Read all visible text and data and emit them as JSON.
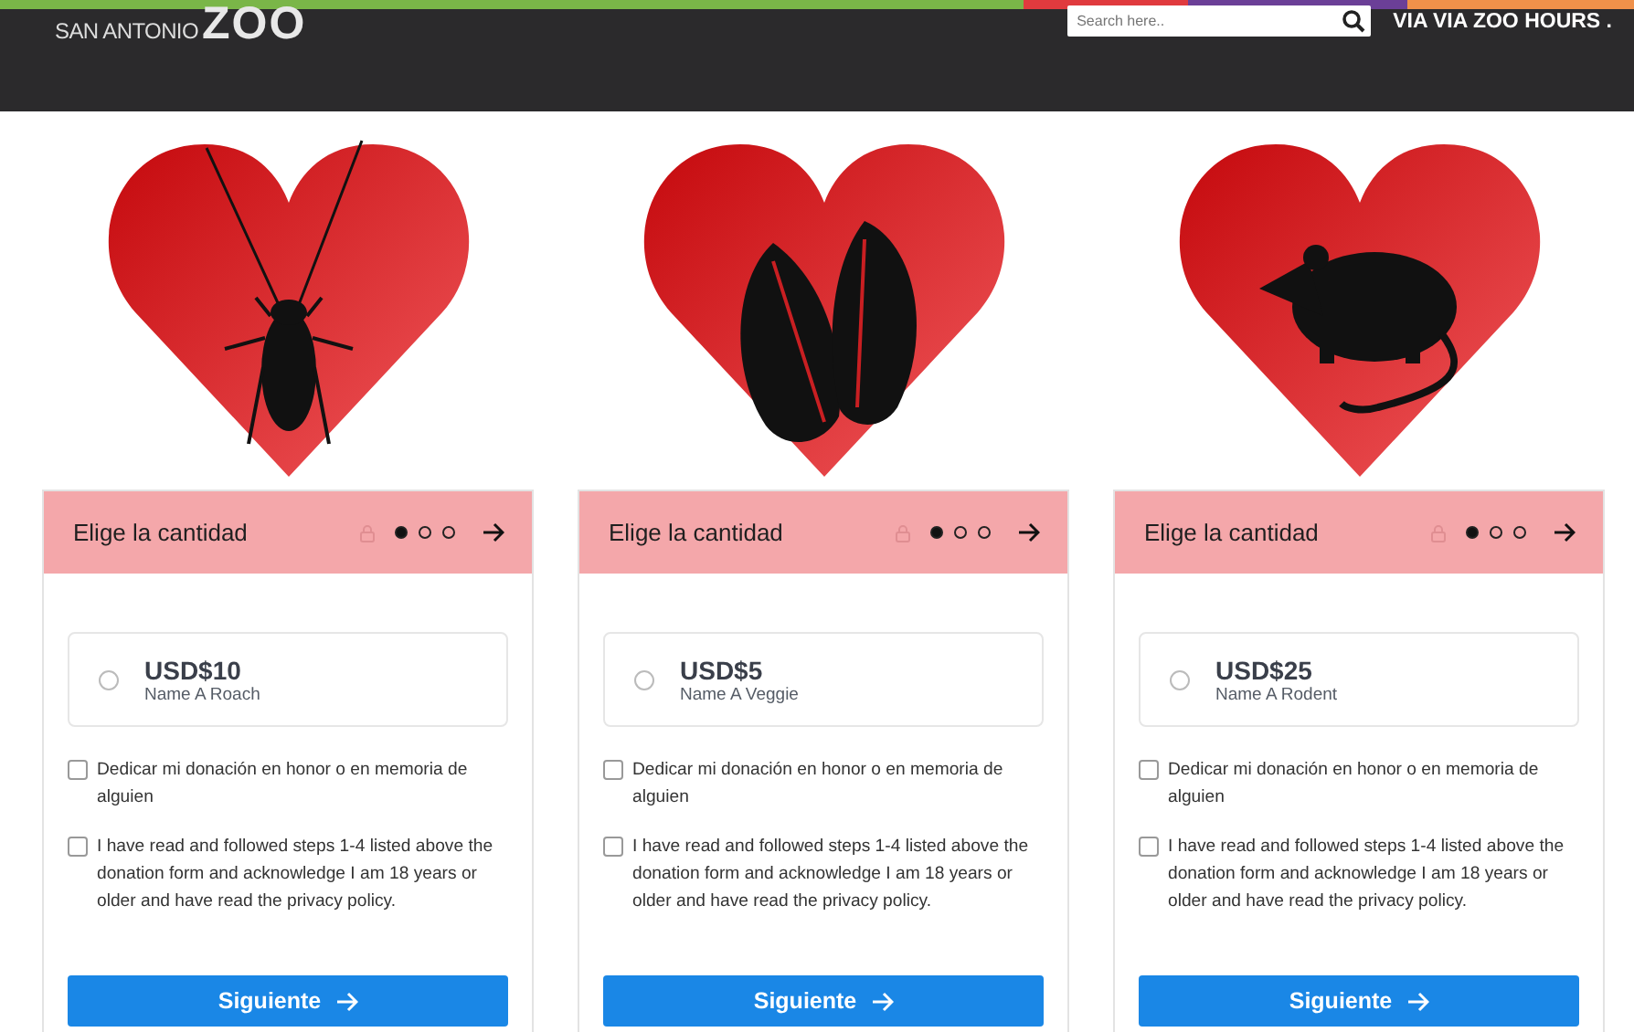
{
  "header": {
    "logo_small": "SAN ANTONIO",
    "logo_large": "ZOO",
    "search": {
      "placeholder": "Search here.."
    },
    "link": "VIA VIA ZOO HOURS ."
  },
  "cards": [
    {
      "kind": "roach",
      "title": "Elige la cantidad",
      "steps": [
        {
          "selected": true
        },
        {
          "selected": false
        },
        {
          "selected": false
        }
      ],
      "amount": "USD$10",
      "item": "Name A Roach",
      "amount_selected": false,
      "options": [
        {
          "label": "Dedicar mi donación en honor o en memoria de alguien",
          "checked": false
        },
        {
          "label": "I have read and followed steps 1-4 listed above the donation form and acknowledge I am 18 years or older and have read the privacy policy.",
          "checked": false
        }
      ],
      "button": "Siguiente"
    },
    {
      "kind": "lettuce",
      "title": "Elige la cantidad",
      "steps": [
        {
          "selected": true
        },
        {
          "selected": false
        },
        {
          "selected": false
        }
      ],
      "amount": "USD$5",
      "item": "Name A Veggie",
      "amount_selected": false,
      "options": [
        {
          "label": "Dedicar mi donación en honor o en memoria de alguien",
          "checked": false
        },
        {
          "label": "I have read and followed steps 1-4 listed above the donation form and acknowledge I am 18 years or older and have read the privacy policy.",
          "checked": false
        }
      ],
      "button": "Siguiente"
    },
    {
      "kind": "rat",
      "title": "Elige la cantidad",
      "steps": [
        {
          "selected": true
        },
        {
          "selected": false
        },
        {
          "selected": false
        }
      ],
      "amount": "USD$25",
      "item": "Name A Rodent",
      "amount_selected": false,
      "options": [
        {
          "label": "Dedicar mi donación en honor o en memoria de alguien",
          "checked": false
        },
        {
          "label": "I have read and followed steps 1-4 listed above the donation form and acknowledge I am 18 years or older and have read the privacy policy.",
          "checked": false
        }
      ],
      "button": "Siguiente"
    }
  ]
}
